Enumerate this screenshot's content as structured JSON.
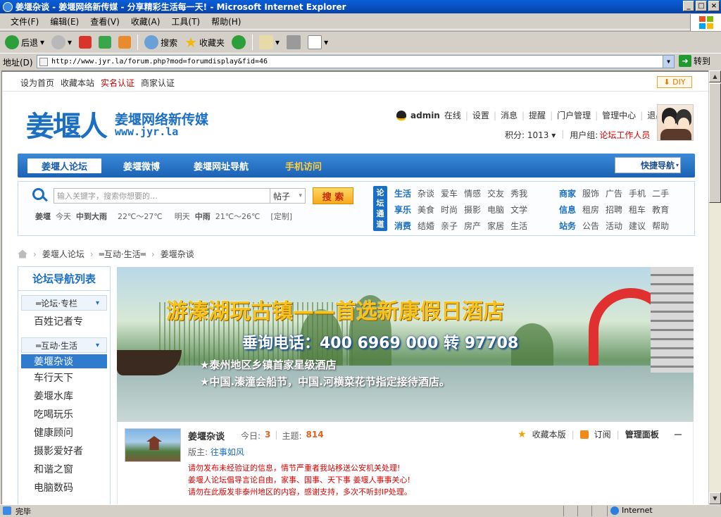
{
  "window": {
    "title": "姜堰杂谈 - 姜堰网络新传媒 - 分享精彩生活每一天! - Microsoft Internet Explorer"
  },
  "menu": [
    "文件(F)",
    "编辑(E)",
    "查看(V)",
    "收藏(A)",
    "工具(T)",
    "帮助(H)"
  ],
  "toolbar": {
    "back": "后退",
    "search": "搜索",
    "favorites": "收藏夹"
  },
  "address": {
    "label": "地址(D)",
    "url": "http://www.jyr.la/forum.php?mod=forumdisplay&fid=46",
    "go": "转到"
  },
  "status": {
    "text": "完毕",
    "zone": "Internet"
  },
  "page": {
    "toplinks": [
      "设为首页",
      "收藏本站",
      "实名认证",
      "商家认证"
    ],
    "diy": "DIY",
    "logo": "姜堰人",
    "logo_sub": "姜堰网络新传媒",
    "logo_url": "www.jyr.la",
    "user": {
      "name": "admin",
      "online": "在线",
      "links": [
        "设置",
        "消息",
        "提醒",
        "门户管理",
        "管理中心",
        "退出"
      ],
      "points_label": "积分: 1013",
      "group_label": "用户组:",
      "group": "论坛工作人员"
    },
    "nav": {
      "items": [
        "姜堰人论坛",
        "姜堰微博",
        "姜堰网址导航",
        "手机访问"
      ],
      "quick": "快捷导航"
    },
    "search": {
      "placeholder": "输入关键字，搜索你想要的…",
      "type": "帖子",
      "button": "搜 索"
    },
    "weather": {
      "city": "姜堰",
      "today_label": "今天",
      "today": "中到大雨",
      "today_temp": "22℃～27℃",
      "tomorrow_label": "明天",
      "tomorrow": "中雨",
      "tomorrow_temp": "21℃～26℃",
      "custom": "[定制]"
    },
    "channel_title": "论坛通道",
    "channels_left": [
      [
        "生活",
        "杂谈",
        "爱车",
        "情感",
        "交友",
        "秀我"
      ],
      [
        "享乐",
        "美食",
        "时尚",
        "摄影",
        "电脑",
        "文学"
      ],
      [
        "消费",
        "结婚",
        "亲子",
        "房产",
        "家居",
        "生活"
      ]
    ],
    "channels_right": [
      [
        "商家",
        "服饰",
        "广告",
        "手机",
        "二手"
      ],
      [
        "信息",
        "租房",
        "招聘",
        "租车",
        "教育"
      ],
      [
        "站务",
        "公告",
        "活动",
        "建议",
        "帮助"
      ]
    ],
    "breadcrumb": [
      "姜堰人论坛",
      "═互动·生活═",
      "姜堰杂谈"
    ],
    "sidebar": {
      "title": "论坛导航列表",
      "cat1": "═论坛·专栏",
      "cat1_items": [
        "百姓记者专"
      ],
      "cat2": "═互动·生活",
      "cat2_items": [
        "姜堰杂谈",
        "车行天下",
        "姜堰水库",
        "吃喝玩乐",
        "健康顾问",
        "摄影爱好者",
        "和谐之窗",
        "电脑数码"
      ]
    },
    "banner": {
      "line1": "游溱湖玩古镇——首选新康假日酒店",
      "line2": "垂询电话：400 6969 000 转 97708",
      "line3": "★泰州地区乡镇首家星级酒店",
      "line4": "★中国.溱潼会船节，中国.河横菜花节指定接待酒店。"
    },
    "forum": {
      "name": "姜堰杂谈",
      "today_label": "今日:",
      "today": "3",
      "topics_label": "主题:",
      "topics": "814",
      "moderator_label": "版主:",
      "moderator": "往事如风",
      "fav": "收藏本版",
      "subscribe": "订阅",
      "manage": "管理面板",
      "notice": [
        "请勿发布未经验证的信息，情节严重者我站移送公安机关处理!",
        "姜堰人论坛倡导言论自由，家事、国事、天下事 姜堰人事事关心!",
        "请勿在此版发非泰州地区的内容，感谢支持，多次不听封IP处理。"
      ]
    }
  }
}
